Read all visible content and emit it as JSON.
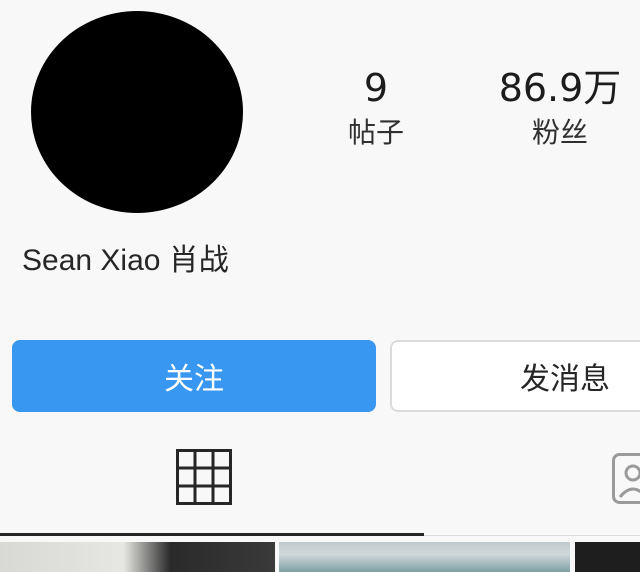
{
  "profile": {
    "username": "Sean Xiao 肖战",
    "avatar_color": "#000000"
  },
  "stats": {
    "posts": {
      "value": "9",
      "label": "帖子"
    },
    "followers": {
      "value": "86.9万",
      "label": "粉丝"
    }
  },
  "actions": {
    "follow_label": "关注",
    "message_label": "发消息",
    "follow_color": "#3897f0"
  },
  "tabs": [
    {
      "icon": "grid-icon",
      "active": true
    },
    {
      "icon": "tagged-person-icon",
      "active": false
    }
  ],
  "posts_preview": [
    "post-thumbnail-1",
    "post-thumbnail-2",
    "post-thumbnail-3"
  ]
}
